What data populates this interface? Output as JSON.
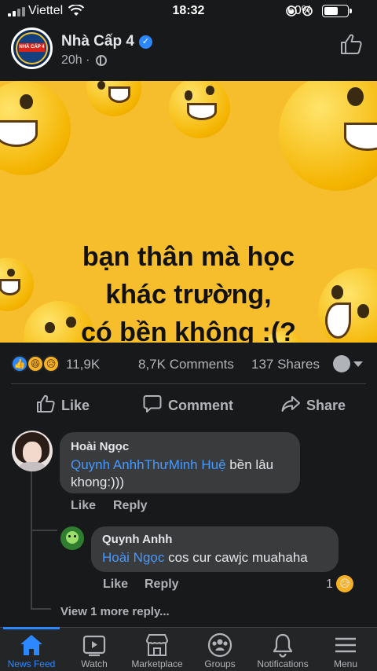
{
  "status_bar": {
    "carrier": "Viettel",
    "time": "18:32",
    "battery": "60%"
  },
  "post": {
    "page_name": "Nhà Cấp 4",
    "time": "20h ·",
    "logo_text": "NHÀ CẤP 4",
    "image_caption": [
      "bạn thân mà học",
      "khác trường,",
      "có bền không :(?"
    ]
  },
  "stats": {
    "reactions": "11,9K",
    "comments": "8,7K Comments",
    "shares": "137 Shares"
  },
  "actions": {
    "like": "Like",
    "comment": "Comment",
    "share": "Share"
  },
  "comments": [
    {
      "author": "Hoài Ngọc",
      "mentions": "Quynh AnhhThưMinh Huệ",
      "text": " bền lâu khong:)))",
      "like": "Like",
      "reply": "Reply"
    }
  ],
  "reply": {
    "author": "Quynh Anhh",
    "mention": "Hoài Ngọc",
    "text": " cos cur cawjc muahaha",
    "like": "Like",
    "reply": "Reply",
    "reaction_count": "1"
  },
  "view_more": "View 1 more reply...",
  "nav": [
    {
      "label": "News Feed",
      "active": true
    },
    {
      "label": "Watch"
    },
    {
      "label": "Marketplace"
    },
    {
      "label": "Groups"
    },
    {
      "label": "Notifications"
    },
    {
      "label": "Menu"
    }
  ],
  "colors": {
    "accent": "#2d88ff",
    "background": "#18191a",
    "bubble": "#3a3b3c",
    "image_bg": "#f6bd2c"
  }
}
